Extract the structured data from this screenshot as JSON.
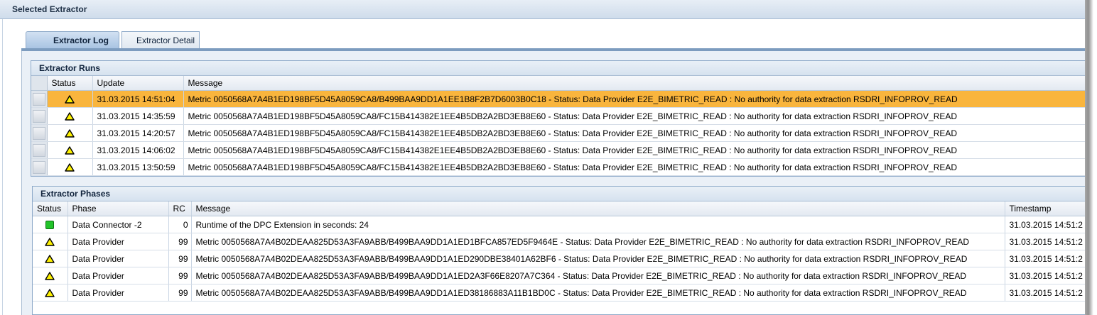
{
  "panel": {
    "title": "Selected Extractor"
  },
  "tabs": [
    {
      "label": "Extractor Log",
      "active": true
    },
    {
      "label": "Extractor Detail",
      "active": false
    }
  ],
  "runs": {
    "title": "Extractor Runs",
    "columns": [
      "Status",
      "Update",
      "Message"
    ],
    "rows": [
      {
        "status": "warning-icon",
        "update": "31.03.2015 14:51:04",
        "message": "Metric 0050568A7A4B1ED198BF5D45A8059CA8/B499BAA9DD1A1EE1B8F2B7D6003B0C18 - Status: Data Provider E2E_BIMETRIC_READ : No authority for data extraction RSDRI_INFOPROV_READ",
        "highlighted": true
      },
      {
        "status": "warning-icon",
        "update": "31.03.2015 14:35:59",
        "message": "Metric 0050568A7A4B1ED198BF5D45A8059CA8/FC15B414382E1EE4B5DB2A2BD3EB8E60 - Status: Data Provider E2E_BIMETRIC_READ : No authority for data extraction RSDRI_INFOPROV_READ",
        "highlighted": false
      },
      {
        "status": "warning-icon",
        "update": "31.03.2015 14:20:57",
        "message": "Metric 0050568A7A4B1ED198BF5D45A8059CA8/FC15B414382E1EE4B5DB2A2BD3EB8E60 - Status: Data Provider E2E_BIMETRIC_READ : No authority for data extraction RSDRI_INFOPROV_READ",
        "highlighted": false
      },
      {
        "status": "warning-icon",
        "update": "31.03.2015 14:06:02",
        "message": "Metric 0050568A7A4B1ED198BF5D45A8059CA8/FC15B414382E1EE4B5DB2A2BD3EB8E60 - Status: Data Provider E2E_BIMETRIC_READ : No authority for data extraction RSDRI_INFOPROV_READ",
        "highlighted": false
      },
      {
        "status": "warning-icon",
        "update": "31.03.2015 13:50:59",
        "message": "Metric 0050568A7A4B1ED198BF5D45A8059CA8/FC15B414382E1EE4B5DB2A2BD3EB8E60 - Status: Data Provider E2E_BIMETRIC_READ : No authority for data extraction RSDRI_INFOPROV_READ",
        "highlighted": false
      }
    ]
  },
  "phases": {
    "title": "Extractor Phases",
    "columns": [
      "Status",
      "Phase",
      "RC",
      "Message",
      "Timestamp"
    ],
    "rows": [
      {
        "status": "ok-icon",
        "phase": "Data Connector -2",
        "rc": "0",
        "message": "Runtime of the DPC Extension in seconds: 24",
        "timestamp": "31.03.2015 14:51:2"
      },
      {
        "status": "warning-icon",
        "phase": "Data Provider",
        "rc": "99",
        "message": "Metric 0050568A7A4B02DEAA825D53A3FA9ABB/B499BAA9DD1A1ED1BFCA857ED5F9464E - Status: Data Provider E2E_BIMETRIC_READ : No authority for data extraction RSDRI_INFOPROV_READ",
        "timestamp": "31.03.2015 14:51:2"
      },
      {
        "status": "warning-icon",
        "phase": "Data Provider",
        "rc": "99",
        "message": "Metric 0050568A7A4B02DEAA825D53A3FA9ABB/B499BAA9DD1A1ED290DBE38401A62BF6 - Status: Data Provider E2E_BIMETRIC_READ : No authority for data extraction RSDRI_INFOPROV_READ",
        "timestamp": "31.03.2015 14:51:2"
      },
      {
        "status": "warning-icon",
        "phase": "Data Provider",
        "rc": "99",
        "message": "Metric 0050568A7A4B02DEAA825D53A3FA9ABB/B499BAA9DD1A1ED2A3F66E8207A7C364 - Status: Data Provider E2E_BIMETRIC_READ : No authority for data extraction RSDRI_INFOPROV_READ",
        "timestamp": "31.03.2015 14:51:2"
      },
      {
        "status": "warning-icon",
        "phase": "Data Provider",
        "rc": "99",
        "message": "Metric 0050568A7A4B02DEAA825D53A3FA9ABB/B499BAA9DD1A1ED38186883A11B1BD0C - Status: Data Provider E2E_BIMETRIC_READ : No authority for data extraction RSDRI_INFOPROV_READ",
        "timestamp": "31.03.2015 14:51:2"
      }
    ]
  },
  "colors": {
    "highlight": "#f9b53d",
    "header": "#cfdceb",
    "tab_active": "#a9c4e3",
    "ok": "#22c32a",
    "warning": "#fff200"
  }
}
